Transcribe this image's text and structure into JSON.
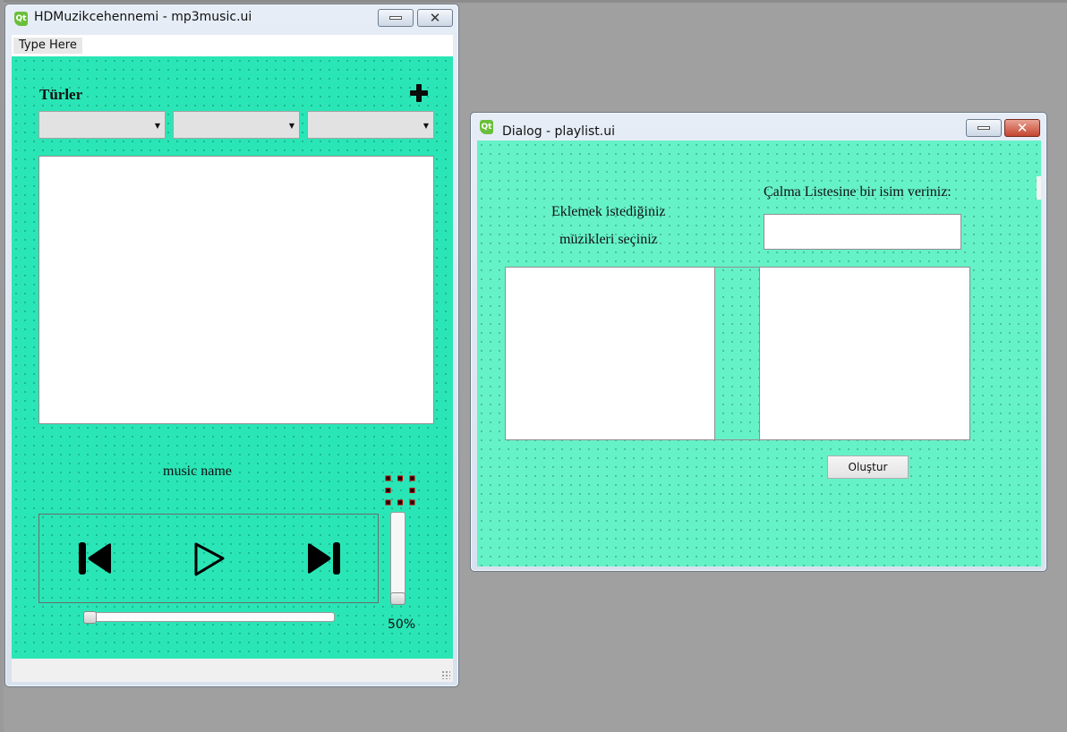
{
  "main_window": {
    "title": "HDMuzikcehennemi - mp3music.ui",
    "menu": {
      "placeholder": "Type Here"
    },
    "genres_label": "Türler",
    "add_icon": "plus-icon",
    "comboboxes": [
      "",
      "",
      ""
    ],
    "music_name": "music name",
    "controls": [
      "previous-icon",
      "play-icon",
      "next-icon"
    ],
    "volume": {
      "value_label": "50%",
      "level": 0
    },
    "progress": {
      "position": 0
    }
  },
  "dialog_window": {
    "title": "Dialog - playlist.ui",
    "select_label_line1": "Eklemek istediğiniz",
    "select_label_line2": "müzikleri seçiniz",
    "name_label": "Çalma Listesine bir isim veriniz:",
    "name_input_value": "",
    "create_button": "Oluştur"
  },
  "colors": {
    "form_background": "#2ae6b6",
    "dialog_background": "#66f2c7",
    "desktop": "#a0a0a0"
  }
}
